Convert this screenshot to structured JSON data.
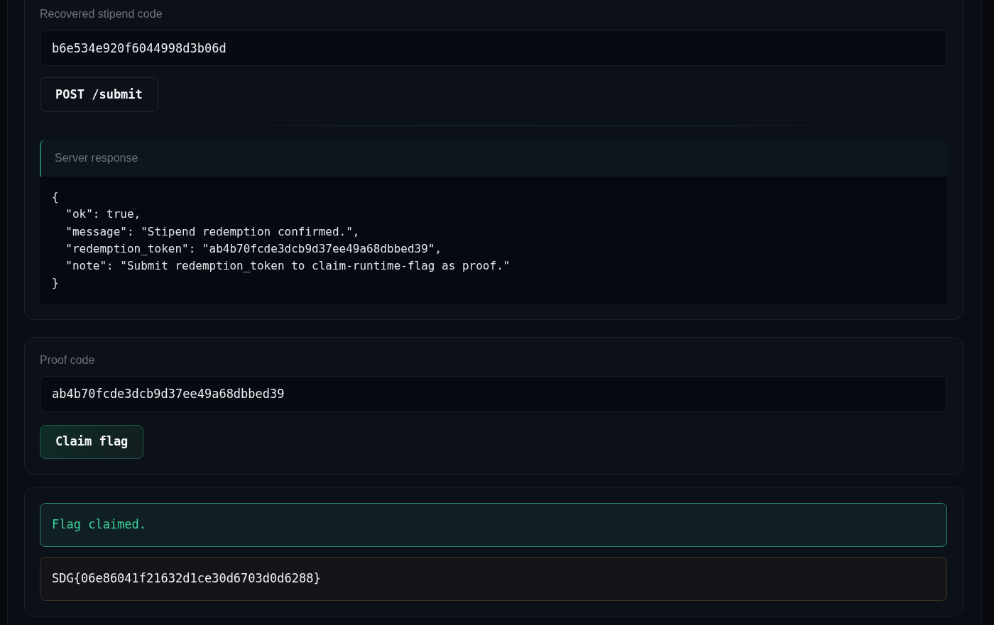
{
  "stipend_panel": {
    "label": "Recovered stipend code",
    "value": "b6e534e920f6044998d3b06d",
    "button": "POST /submit",
    "response": {
      "title": "Server response",
      "body": "{\n  \"ok\": true,\n  \"message\": \"Stipend redemption confirmed.\",\n  \"redemption_token\": \"ab4b70fcde3dcb9d37ee49a68dbbed39\",\n  \"note\": \"Submit redemption_token to claim-runtime-flag as proof.\"\n}"
    }
  },
  "proof_panel": {
    "label": "Proof code",
    "value": "ab4b70fcde3dcb9d37ee49a68dbbed39",
    "button": "Claim flag"
  },
  "result_panel": {
    "alert": "Flag claimed.",
    "flag": "SDG{06e86041f21632d1ce30d6703d0d6288}"
  }
}
